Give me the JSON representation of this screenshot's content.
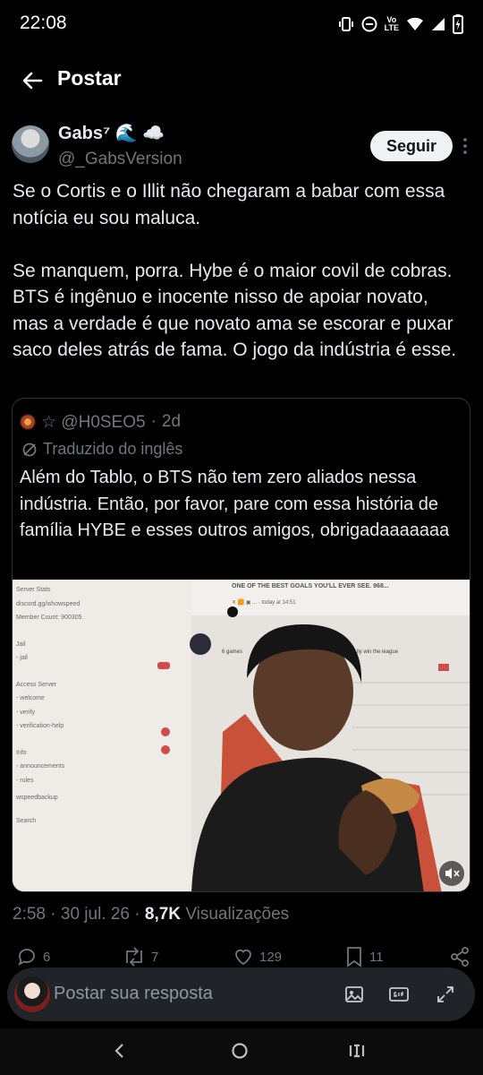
{
  "status_bar": {
    "time": "22:08",
    "volte": "Vo\nLTE",
    "icons": [
      "vibrate-icon",
      "dnd-icon",
      "volte-icon",
      "wifi-icon",
      "signal-icon",
      "battery-icon"
    ]
  },
  "header": {
    "title": "Postar"
  },
  "post": {
    "author_name": "Gabs⁷ 🌊 ☁️",
    "handle": "@_GabsVersion",
    "follow_label": "Seguir",
    "text": "Se o Cortis e o Illit não chegaram a babar com essa notícia eu sou maluca.\n\nSe manquem, porra. Hybe é o maior covil de cobras. BTS é ingênuo e inocente nisso de apoiar novato, mas a verdade é que novato ama se escorar e puxar saco deles atrás de fama. O jogo da indústria é esse.",
    "time": "2:58",
    "date": "30 jul. 26",
    "views": "8,7K",
    "views_label": "Visualizações"
  },
  "quote": {
    "handle": "☆ @H0SEO5",
    "age": "2d",
    "translated_label": "Traduzido do inglês",
    "text": "Além do Tablo, o BTS não tem zero aliados nessa indústria. Então, por favor, pare com essa história de família HYBE e esses outros amigos, obrigadaaaaaaa",
    "media": {
      "top_title": "ONE OF THE BEST GOALS YOU'LL EVER SEE. 968...",
      "sub_line": "✕ 🟧 ▣ ... · today at 14:51",
      "chat_line": "6 games",
      "chat_line2": "lly win the league",
      "sidebar": [
        "Server Stats",
        "discord.gg/ishowspeed",
        "Member Count: 900305",
        "Jail",
        "- jail",
        "Access Server",
        "- welcome",
        "- verify",
        "- verification-help",
        "Info",
        "- announcements",
        "- rules",
        "wspeedbackup",
        "Search"
      ]
    }
  },
  "actions": {
    "replies": "6",
    "reposts": "7",
    "likes": "129",
    "bookmarks": "11"
  },
  "reply_bar": {
    "placeholder": "Postar sua resposta"
  },
  "colors": {
    "background": "#000000",
    "text": "#e7e9ea",
    "muted": "#71767b",
    "border": "#2f3336",
    "follow_bg": "#eff3f4"
  }
}
